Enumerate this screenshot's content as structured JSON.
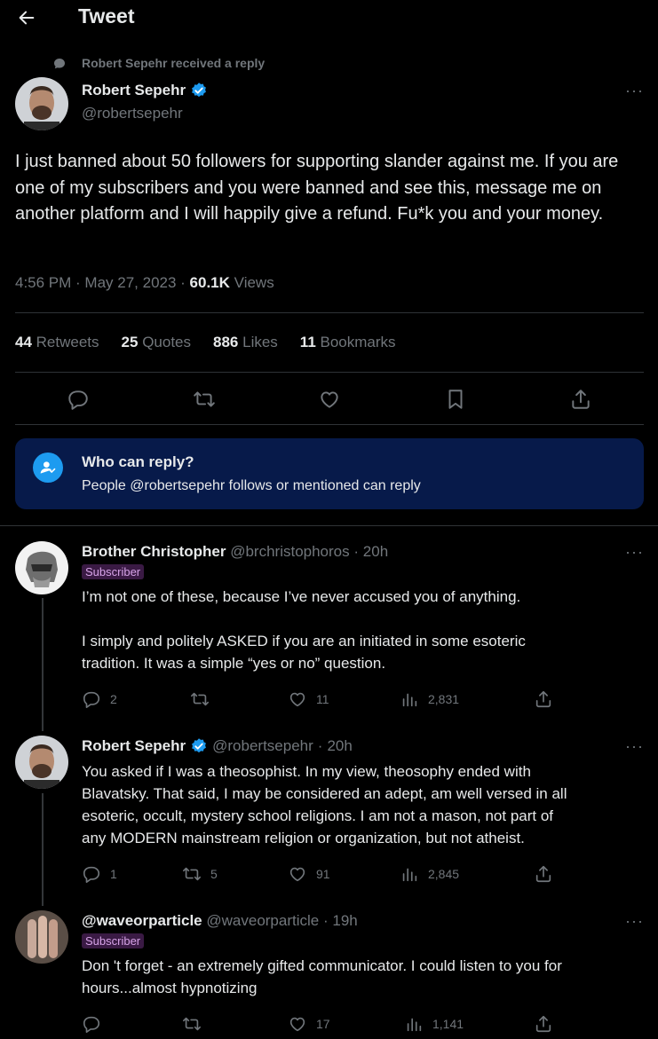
{
  "header": {
    "title": "Tweet"
  },
  "social_context": "Robert Sepehr received a reply",
  "main_tweet": {
    "name": "Robert Sepehr",
    "handle": "@robertsepehr",
    "more": "···",
    "text": "I just banned about 50 followers for supporting slander against me. If you are one of my subscribers and you were banned and see this, message me on another platform and I will happily give a refund. Fu*k you and your money.",
    "time": "4:56 PM",
    "date": "May 27, 2023",
    "views_count": "60.1K",
    "views_label": "Views",
    "stats": [
      {
        "count": "44",
        "label": "Retweets"
      },
      {
        "count": "25",
        "label": "Quotes"
      },
      {
        "count": "886",
        "label": "Likes"
      },
      {
        "count": "11",
        "label": "Bookmarks"
      }
    ]
  },
  "who_can_reply": {
    "title": "Who can reply?",
    "subtitle": "People @robertsepehr follows or mentioned can reply"
  },
  "replies": [
    {
      "name": "Brother Christopher",
      "handle": "@brchristophoros",
      "time": "20h",
      "badge": "Subscriber",
      "text_lines": [
        "I’m not one of these, because I’ve never accused you of anything.",
        "",
        "I simply and politely ASKED if you are an initiated in some esoteric",
        "tradition. It was a simple “yes or no” question."
      ],
      "replies": "2",
      "retweets": "",
      "likes": "11",
      "views": "2,831"
    },
    {
      "name": "Robert Sepehr",
      "handle": "@robertsepehr",
      "time": "20h",
      "badge": "",
      "text_lines": [
        "You asked if I was a theosophist. In my view, theosophy ended with",
        "Blavatsky. That said, I may be considered an adept, am well versed in all",
        "esoteric, occult, mystery school religions. I am not a mason, not part of",
        "any MODERN mainstream religion or organization, but not atheist."
      ],
      "replies": "1",
      "retweets": "5",
      "likes": "91",
      "views": "2,845"
    },
    {
      "name": "@waveorparticle",
      "handle": "@waveorparticle",
      "time": "19h",
      "badge": "Subscriber",
      "text_lines": [
        "Don 't forget - an extremely gifted communicator. I could listen to you for",
        "hours...almost hypnotizing"
      ],
      "replies": "",
      "retweets": "",
      "likes": "17",
      "views": "1,141"
    }
  ],
  "colors": {
    "accent": "#1d9bf0",
    "background": "#000000",
    "muted": "#71767b",
    "who_can_reply_bg": "#071a4a"
  }
}
